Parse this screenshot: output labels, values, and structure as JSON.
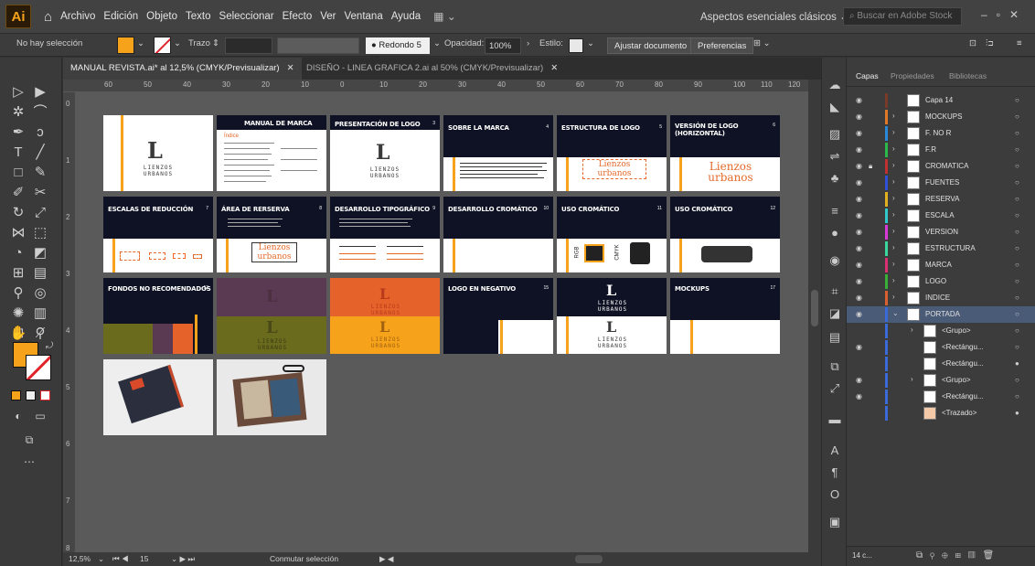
{
  "app": {
    "logo": "Ai",
    "menu": [
      "Archivo",
      "Edición",
      "Objeto",
      "Texto",
      "Seleccionar",
      "Efecto",
      "Ver",
      "Ventana",
      "Ayuda"
    ],
    "workspace": "Aspectos esenciales clásicos",
    "search_placeholder": "Buscar en Adobe Stock"
  },
  "control_bar": {
    "selection": "No hay selección",
    "stroke_label": "Trazo",
    "brush": "Redondo 5 ...",
    "opacity_label": "Opacidad:",
    "opacity_value": "100%",
    "style_label": "Estilo:",
    "fit_button": "Ajustar documento",
    "prefs_button": "Preferencias",
    "colors": {
      "fill": "#f7a21b",
      "stroke_slash": "#e0242b"
    }
  },
  "tabs": [
    {
      "label": "MANUAL REVISTA.ai* al 12,5% (CMYK/Previsualizar)",
      "active": true
    },
    {
      "label": "DISEÑO - LINEA GRAFICA 2.ai al 50% (CMYK/Previsualizar)",
      "active": false
    }
  ],
  "rulers": {
    "top": [
      "60",
      "50",
      "40",
      "30",
      "20",
      "10",
      "0",
      "10",
      "20",
      "30",
      "40",
      "50",
      "60",
      "70",
      "80",
      "90",
      "100",
      "110",
      "120"
    ],
    "left": [
      "0",
      "1",
      "2",
      "3",
      "4",
      "5",
      "6",
      "7",
      "8"
    ]
  },
  "artboards": {
    "logo_lines": [
      "LIENZOS",
      "URBANOS"
    ],
    "logo_orange": [
      "Lienzos",
      "urbanos"
    ],
    "titles": {
      "a2": "MANUAL DE MARCA",
      "a2_sub": "Índice",
      "a3": "PRESENTACIÓN DE LOGO",
      "a4": "SOBRE LA MARCA",
      "a5": "ESTRUCTURA DE LOGO",
      "a6": "VERSIÓN DE LOGO (HORIZONTAL)",
      "a7": "ESCALAS DE REDUCCIÓN",
      "a8": "ÁREA DE RERSERVA",
      "a9": "DESARROLLO TIPOGRÁFICO",
      "a10": "DESARROLLO CROMÁTICO",
      "a11": "USO CROMÁTICO",
      "a12": "USO CROMÁTICO",
      "a13": "FONDOS NO RECOMENDADOS",
      "a16": "LOGO EN NEGATIVO",
      "a17": "MOCKUPS"
    },
    "numbers": {
      "a3": "3",
      "a4": "4",
      "a5": "5",
      "a6": "6",
      "a7": "7",
      "a8": "8",
      "a9": "9",
      "a10": "10",
      "a11": "11",
      "a12": "12",
      "a13": "13",
      "a16": "15",
      "a17": "17"
    },
    "rgb": "RGB",
    "cmyk": "CMYK"
  },
  "layers_panel": {
    "tabs": [
      "Capas",
      "Propiedades",
      "Bibliotecas"
    ],
    "layers": [
      {
        "name": "Capa 14",
        "color": "#7a3a2a"
      },
      {
        "name": "MOCKUPS",
        "color": "#e0782a"
      },
      {
        "name": "F. NO R",
        "color": "#2a8ad8"
      },
      {
        "name": "F.R",
        "color": "#2ab84a"
      },
      {
        "name": "CROMATICA",
        "color": "#c03030"
      },
      {
        "name": "FUENTES",
        "color": "#3050d8"
      },
      {
        "name": "RESERVA",
        "color": "#e0b020"
      },
      {
        "name": "ESCALA",
        "color": "#30c8c8"
      },
      {
        "name": "VERSION",
        "color": "#d83ad8"
      },
      {
        "name": "ESTRUCTURA",
        "color": "#3ad8a0"
      },
      {
        "name": "MARCA",
        "color": "#d83070"
      },
      {
        "name": "LOGO",
        "color": "#38b038"
      },
      {
        "name": "INDICE",
        "color": "#d86030"
      },
      {
        "name": "PORTADA",
        "color": "#3a6ad8"
      }
    ],
    "sublayers": [
      "<Grupo>",
      "<Rectángu...",
      "<Rectángu...",
      "<Grupo>",
      "<Rectángu...",
      "<Trazado>"
    ],
    "footer": "14 c..."
  },
  "status": {
    "zoom": "12,5%",
    "page": "15",
    "mode": "Conmutar selección"
  }
}
